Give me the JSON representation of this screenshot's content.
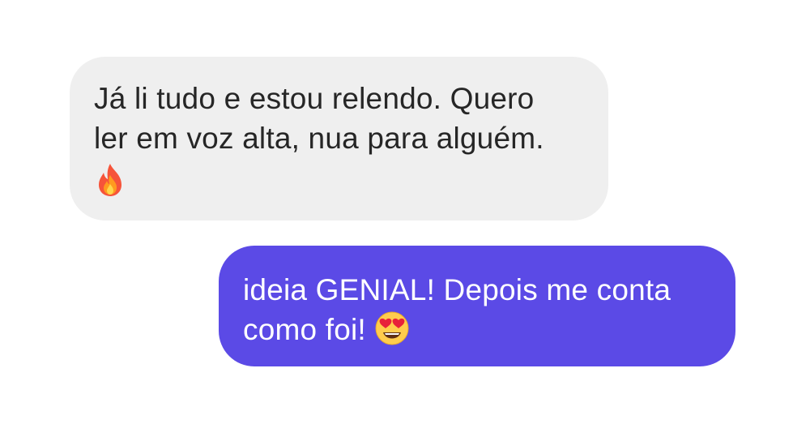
{
  "conversation": {
    "incoming_message": {
      "lines": [
        "Já li tudo e estou relendo. Quero",
        "ler em voz alta, nua para alguém."
      ],
      "emoji": "fire-emoji"
    },
    "outgoing_message": {
      "lines": [
        "ideia GENIAL! Depois me conta",
        "como foi!"
      ],
      "emoji": "heart-eyes-emoji"
    }
  },
  "colors": {
    "incoming_bubble": "#efefef",
    "incoming_text": "#262626",
    "outgoing_bubble": "#5b4ae6",
    "outgoing_text": "#ffffff"
  }
}
